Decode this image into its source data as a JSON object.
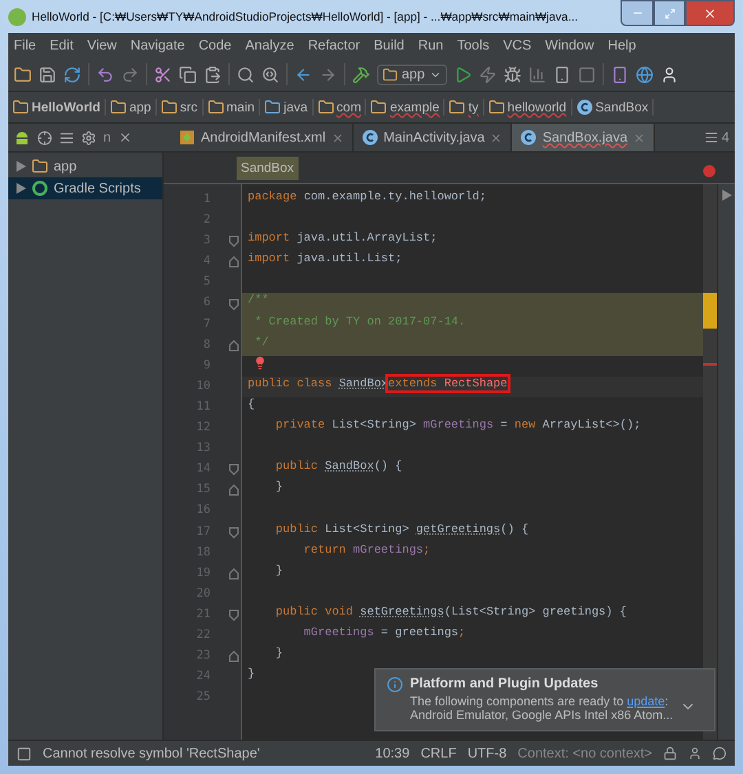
{
  "window": {
    "title": "HelloWorld - [C:₩Users₩TY₩AndroidStudioProjects₩HelloWorld] - [app] - ...₩app₩src₩main₩java..."
  },
  "menu": [
    "File",
    "Edit",
    "View",
    "Navigate",
    "Code",
    "Analyze",
    "Refactor",
    "Build",
    "Run",
    "Tools",
    "VCS",
    "Window",
    "Help"
  ],
  "run_config": "app",
  "breadcrumbs": [
    {
      "label": "HelloWorld",
      "kind": "module"
    },
    {
      "label": "app",
      "kind": "module"
    },
    {
      "label": "src",
      "kind": "folder"
    },
    {
      "label": "main",
      "kind": "folder"
    },
    {
      "label": "java",
      "kind": "source"
    },
    {
      "label": "com",
      "kind": "package"
    },
    {
      "label": "example",
      "kind": "package"
    },
    {
      "label": "ty",
      "kind": "package"
    },
    {
      "label": "helloworld",
      "kind": "package"
    },
    {
      "label": "SandBox",
      "kind": "class"
    }
  ],
  "tool_row": {
    "overflow_text": "n"
  },
  "tabs": [
    {
      "label": "AndroidManifest.xml",
      "kind": "xml",
      "selected": false,
      "error": false
    },
    {
      "label": "MainActivity.java",
      "kind": "class",
      "selected": false,
      "error": false
    },
    {
      "label": "SandBox.java",
      "kind": "class",
      "selected": true,
      "error": true
    }
  ],
  "hidden_tab_count": "4",
  "project_tree": [
    {
      "label": "app",
      "kind": "module",
      "selected": false
    },
    {
      "label": "Gradle Scripts",
      "kind": "gradle",
      "selected": true
    }
  ],
  "editor": {
    "breadcrumb": "SandBox",
    "lines": [
      {
        "number": "1",
        "tokens": [
          {
            "text": "package",
            "kind": "keyword"
          },
          {
            "text": " com.example.ty.helloworld;",
            "kind": "plain"
          }
        ]
      },
      {
        "number": "2"
      },
      {
        "number": "3",
        "fold_start": true,
        "tokens": [
          {
            "text": "import",
            "kind": "keyword"
          },
          {
            "text": " java.util.ArrayList;",
            "kind": "plain"
          }
        ]
      },
      {
        "number": "4",
        "fold_end": true,
        "tokens": [
          {
            "text": "import",
            "kind": "keyword"
          },
          {
            "text": " java.util.List;",
            "kind": "plain"
          }
        ]
      },
      {
        "number": "5"
      },
      {
        "number": "6",
        "fold_start": true,
        "highlighted": true,
        "tokens": [
          {
            "text": "/**",
            "kind": "comment"
          }
        ]
      },
      {
        "number": "7",
        "highlighted": true,
        "tokens": [
          {
            "text": " * Created by TY on 2017-07-14.",
            "kind": "comment"
          }
        ]
      },
      {
        "number": "8",
        "fold_end": true,
        "highlighted": true,
        "tokens": [
          {
            "text": " */",
            "kind": "comment"
          }
        ]
      },
      {
        "number": "9",
        "bulb": true
      },
      {
        "number": "10",
        "current": true,
        "tokens": [
          {
            "text": "public class ",
            "kind": "keyword"
          },
          {
            "text": "SandBox",
            "kind": "unused"
          },
          {
            "kind": "box",
            "tokens": [
              {
                "text": "extends ",
                "kind": "keyword"
              },
              {
                "text": "RectShape",
                "kind": "error"
              }
            ]
          }
        ]
      },
      {
        "number": "11",
        "tokens": [
          {
            "text": "{",
            "kind": "plain"
          }
        ]
      },
      {
        "number": "12",
        "tokens": [
          {
            "text": "    private ",
            "kind": "keyword"
          },
          {
            "text": "List<String> ",
            "kind": "plain"
          },
          {
            "text": "mGreetings",
            "kind": "field"
          },
          {
            "text": " = ",
            "kind": "plain"
          },
          {
            "text": "new ",
            "kind": "keyword"
          },
          {
            "text": "ArrayList<>();",
            "kind": "plain"
          }
        ]
      },
      {
        "number": "13"
      },
      {
        "number": "14",
        "fold_start": true,
        "tokens": [
          {
            "text": "    public ",
            "kind": "keyword"
          },
          {
            "text": "SandBox",
            "kind": "unused"
          },
          {
            "text": "() {",
            "kind": "plain"
          }
        ]
      },
      {
        "number": "15",
        "fold_end": true,
        "tokens": [
          {
            "text": "    }",
            "kind": "plain"
          }
        ]
      },
      {
        "number": "16"
      },
      {
        "number": "17",
        "fold_start": true,
        "tokens": [
          {
            "text": "    public ",
            "kind": "keyword"
          },
          {
            "text": "List<String> ",
            "kind": "plain"
          },
          {
            "text": "getGreetings",
            "kind": "unused"
          },
          {
            "text": "() {",
            "kind": "plain"
          }
        ]
      },
      {
        "number": "18",
        "tokens": [
          {
            "text": "        return ",
            "kind": "keyword"
          },
          {
            "text": "mGreetings",
            "kind": "field"
          },
          {
            "text": ";",
            "kind": "keyword"
          }
        ]
      },
      {
        "number": "19",
        "fold_end": true,
        "tokens": [
          {
            "text": "    }",
            "kind": "plain"
          }
        ]
      },
      {
        "number": "20"
      },
      {
        "number": "21",
        "fold_start": true,
        "tokens": [
          {
            "text": "    public void ",
            "kind": "keyword"
          },
          {
            "text": "setGreetings",
            "kind": "unused"
          },
          {
            "text": "(List<String> greetings) {",
            "kind": "plain"
          }
        ]
      },
      {
        "number": "22",
        "tokens": [
          {
            "text": "        mGreetings",
            "kind": "field"
          },
          {
            "text": " = greetings",
            "kind": "plain"
          },
          {
            "text": ";",
            "kind": "keyword"
          }
        ]
      },
      {
        "number": "23",
        "fold_end": true,
        "tokens": [
          {
            "text": "    }",
            "kind": "plain"
          }
        ]
      },
      {
        "number": "24",
        "tokens": [
          {
            "text": "}",
            "kind": "plain"
          }
        ]
      },
      {
        "number": "25"
      }
    ]
  },
  "notification": {
    "title": "Platform and Plugin Updates",
    "text": "The following components are ready to ",
    "link": "update",
    "after_link": ":",
    "detail": "Android Emulator, Google APIs Intel x86 Atom..."
  },
  "status_bar": {
    "message": "Cannot resolve symbol 'RectShape'",
    "position": "10:39",
    "line_separator": "CRLF",
    "encoding": "UTF-8",
    "context": "Context: <no context>"
  }
}
